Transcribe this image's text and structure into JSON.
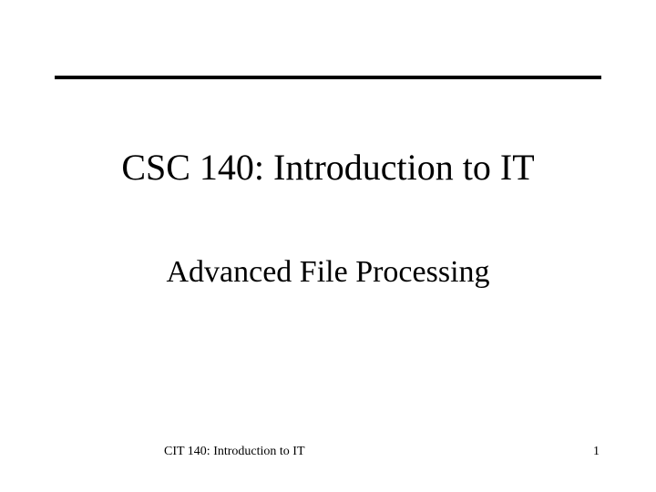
{
  "title": "CSC 140: Introduction to IT",
  "subtitle": "Advanced File Processing",
  "footer": "CIT 140: Introduction to IT",
  "page_number": "1"
}
